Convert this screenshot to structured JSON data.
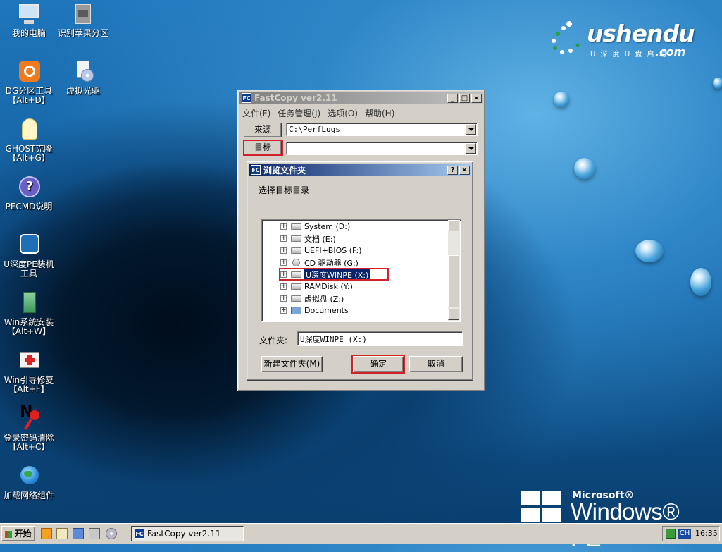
{
  "desktop": {
    "icons": [
      {
        "label": "我的电脑"
      },
      {
        "label": "识别苹果分区"
      },
      {
        "label": "DG分区工具",
        "hotkey": "【Alt+D】"
      },
      {
        "label": "虚拟光驱"
      },
      {
        "label": "GHOST克隆",
        "hotkey": "【Alt+G】"
      },
      {
        "label": "PECMD说明"
      },
      {
        "label": "U深度PE装机",
        "label2": "工具"
      },
      {
        "label": "Win系统安装",
        "hotkey": "【Alt+W】"
      },
      {
        "label": "Win引导修复",
        "hotkey": "【Alt+F】"
      },
      {
        "label": "登录密码清除",
        "hotkey": "【Alt+C】"
      },
      {
        "label": "加载网络组件"
      }
    ],
    "brand": {
      "word": "ushendu",
      "sub": "U 深 度 U 盘 启 动",
      "com": ".com"
    },
    "winpe": {
      "ms": "Microsoft®",
      "text": "Windows® PE"
    }
  },
  "fastcopy": {
    "title": "FastCopy ver2.11",
    "icon": "FC",
    "min": "_",
    "max": "□",
    "close": "×",
    "menu": [
      "文件(F)",
      "任务管理(J)",
      "选项(O)",
      "帮助(H)"
    ],
    "source_label": "来源",
    "source_value": "C:\\PerfLogs",
    "dest_label": "目标",
    "dest_value": ""
  },
  "browse": {
    "title": "浏览文件夹",
    "icon": "FC",
    "help": "?",
    "close": "×",
    "prompt": "选择目标目录",
    "tree": [
      {
        "label": "System (D:)",
        "type": "drive"
      },
      {
        "label": "文档 (E:)",
        "type": "drive"
      },
      {
        "label": "UEFI+BIOS (F:)",
        "type": "drive"
      },
      {
        "label": "CD 驱动器 (G:)",
        "type": "cd"
      },
      {
        "label": "U深度WINPE (X:)",
        "type": "drive",
        "selected": true
      },
      {
        "label": "RAMDisk (Y:)",
        "type": "drive"
      },
      {
        "label": "虚拟盘 (Z:)",
        "type": "drive"
      },
      {
        "label": "Documents",
        "type": "folder"
      }
    ],
    "folder_label": "文件夹:",
    "folder_value": "U深度WINPE (X:)",
    "new_folder": "新建文件夹(M)",
    "ok": "确定",
    "cancel": "取消"
  },
  "taskbar": {
    "start": "开始",
    "task": "FastCopy ver2.11",
    "task_icon": "FC",
    "lang": "CH",
    "time": "16:35"
  },
  "colors": {
    "highlight": "#d0202a",
    "title_active": "#0a246a"
  }
}
